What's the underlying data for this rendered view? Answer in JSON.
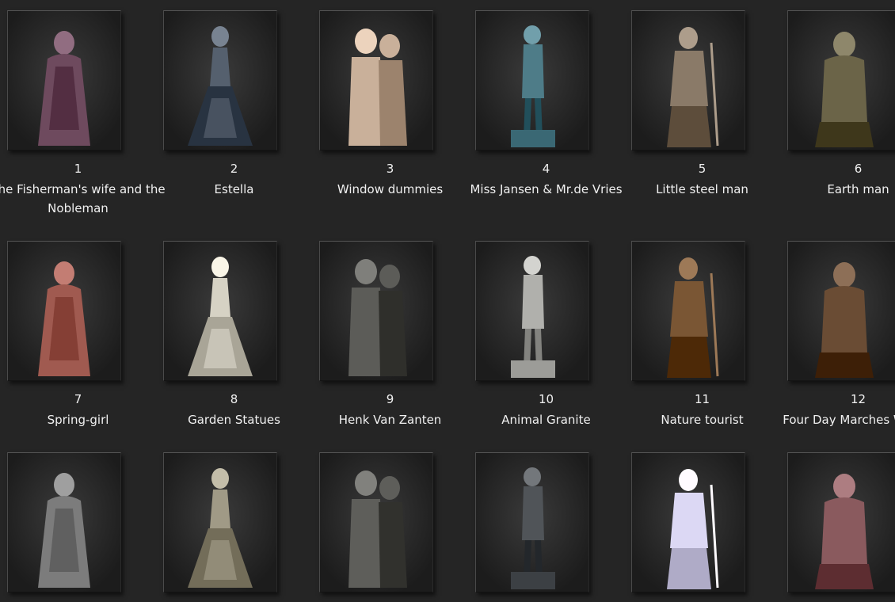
{
  "gallery": {
    "items": [
      {
        "number": "1",
        "title": "The Fisherman's wife and the Nobleman",
        "figure": "fisherman-wife-nobleman-statue",
        "tone": "#6e4a5e"
      },
      {
        "number": "2",
        "title": "Estella",
        "figure": "estella-statue",
        "tone": "#55606e"
      },
      {
        "number": "3",
        "title": "Window dummies",
        "figure": "window-dummy-figure",
        "tone": "#c9b09a"
      },
      {
        "number": "4",
        "title": "Miss Jansen & Mr.de Vries",
        "figure": "jansen-de-vries-statue",
        "tone": "#4e7c88"
      },
      {
        "number": "5",
        "title": "Little steel man",
        "figure": "steel-man-statues",
        "tone": "#8a7a68"
      },
      {
        "number": "6",
        "title": "Earth man",
        "figure": "earth-man-statue",
        "tone": "#6b6448"
      },
      {
        "number": "7",
        "title": "Spring-girl",
        "figure": "spring-girl-statue",
        "tone": "#a05a50"
      },
      {
        "number": "8",
        "title": "Garden Statues",
        "figure": "garden-statue",
        "tone": "#d6d2c4"
      },
      {
        "number": "9",
        "title": "Henk Van Zanten",
        "figure": "henk-van-zanten-statue",
        "tone": "#5c5c58"
      },
      {
        "number": "10",
        "title": "Animal Granite",
        "figure": "animal-granite-statues",
        "tone": "#b0b0ac"
      },
      {
        "number": "11",
        "title": "Nature tourist",
        "figure": "nature-tourist-statue",
        "tone": "#7a5634"
      },
      {
        "number": "12",
        "title": "Four Day Marches Walker",
        "figure": "four-day-marches-statue",
        "tone": "#6a4c34"
      },
      {
        "number": "",
        "title": "",
        "figure": "carriage-statue",
        "tone": "#7c7c7c"
      },
      {
        "number": "",
        "title": "",
        "figure": "seated-man-with-dove-statue",
        "tone": "#a09a86"
      },
      {
        "number": "",
        "title": "",
        "figure": "woman-with-egg-statue",
        "tone": "#5e5e5a"
      },
      {
        "number": "",
        "title": "",
        "figure": "musketeer-statue",
        "tone": "#505458"
      },
      {
        "number": "",
        "title": "",
        "figure": "ice-queen-statue",
        "tone": "#dcd8f4"
      },
      {
        "number": "",
        "title": "",
        "figure": "shrine-madonna-statue",
        "tone": "#8a5a5e"
      }
    ]
  }
}
